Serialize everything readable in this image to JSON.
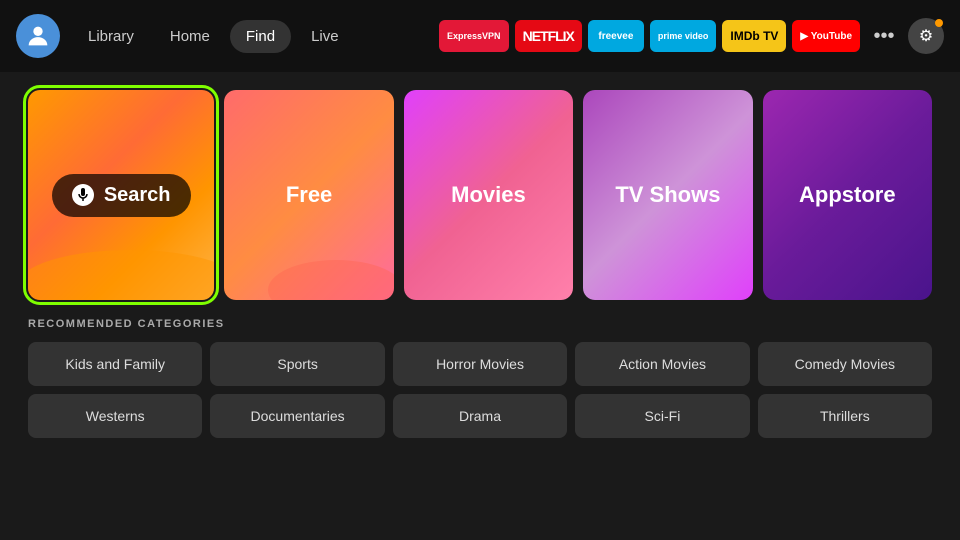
{
  "nav": {
    "links": [
      {
        "label": "Library",
        "active": false
      },
      {
        "label": "Home",
        "active": false
      },
      {
        "label": "Find",
        "active": true
      },
      {
        "label": "Live",
        "active": false
      }
    ],
    "apps": [
      {
        "label": "ExpressVPN",
        "class": "badge-express"
      },
      {
        "label": "NETFLIX",
        "class": "badge-netflix"
      },
      {
        "label": "freevee",
        "class": "badge-freevee"
      },
      {
        "label": "prime video",
        "class": "badge-prime"
      },
      {
        "label": "IMDb TV",
        "class": "badge-imdb"
      },
      {
        "label": "▶ YouTube",
        "class": "badge-youtube"
      }
    ],
    "more_label": "•••",
    "settings_label": "⚙"
  },
  "tiles": [
    {
      "id": "search",
      "label": "Search",
      "class": "tile-search"
    },
    {
      "id": "free",
      "label": "Free",
      "class": "tile-free"
    },
    {
      "id": "movies",
      "label": "Movies",
      "class": "tile-movies"
    },
    {
      "id": "tvshows",
      "label": "TV Shows",
      "class": "tile-tvshows"
    },
    {
      "id": "appstore",
      "label": "Appstore",
      "class": "tile-appstore"
    }
  ],
  "recommended": {
    "section_title": "RECOMMENDED CATEGORIES",
    "row1": [
      {
        "label": "Kids and Family"
      },
      {
        "label": "Sports"
      },
      {
        "label": "Horror Movies"
      },
      {
        "label": "Action Movies"
      },
      {
        "label": "Comedy Movies"
      }
    ],
    "row2": [
      {
        "label": "Westerns"
      },
      {
        "label": "Documentaries"
      },
      {
        "label": "Drama"
      },
      {
        "label": "Sci-Fi"
      },
      {
        "label": "Thrillers"
      }
    ]
  },
  "colors": {
    "accent_green": "#7fff00",
    "bg_dark": "#1a1a1a",
    "nav_bg": "#111"
  }
}
